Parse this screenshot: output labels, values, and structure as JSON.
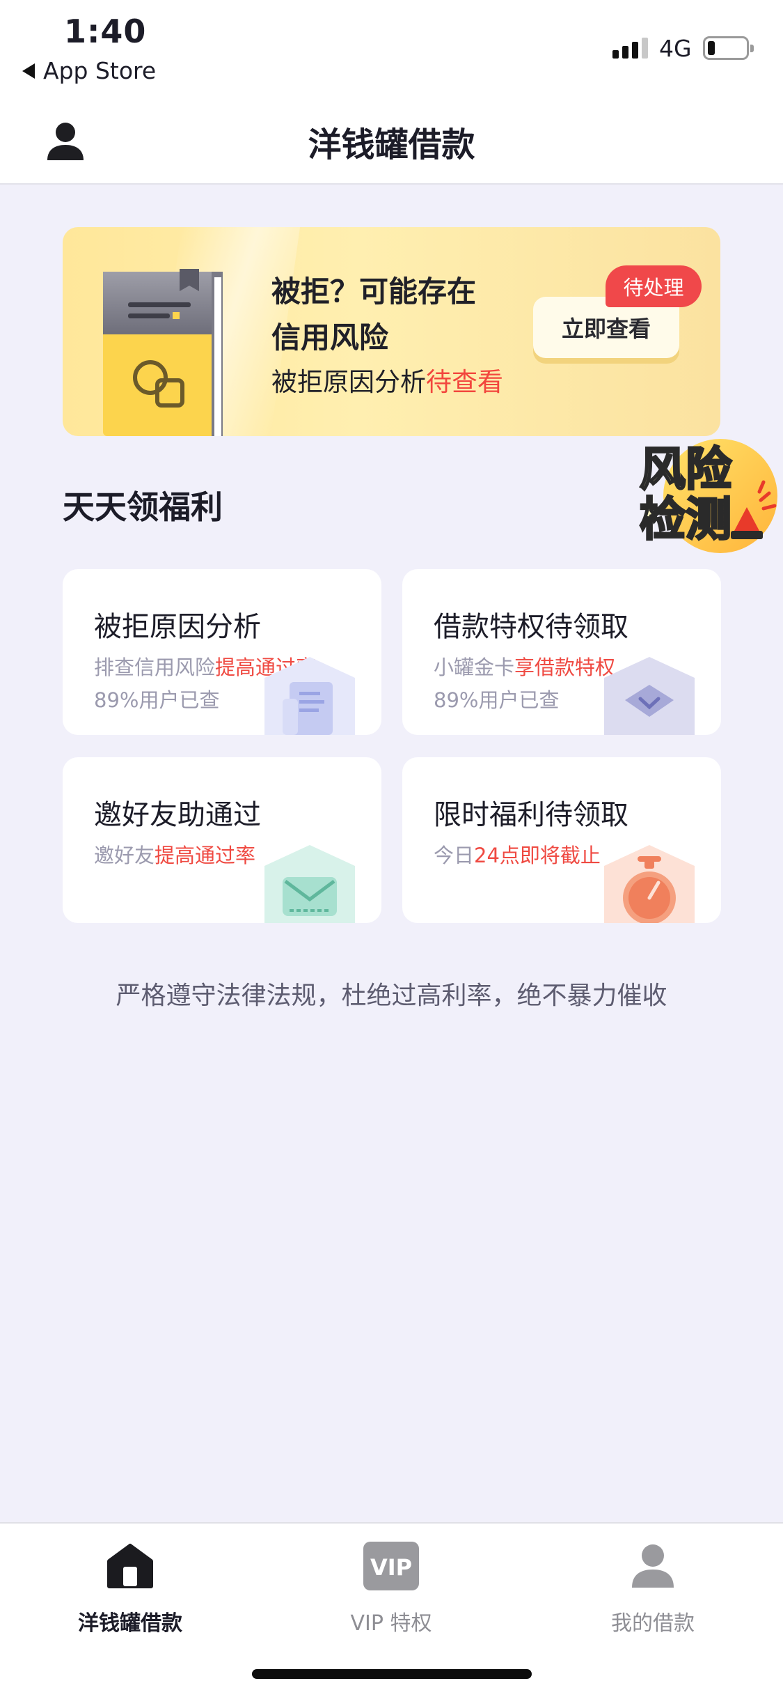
{
  "status_bar": {
    "time": "1:40",
    "back_label": "App Store",
    "network": "4G",
    "battery_level": 0.2
  },
  "header": {
    "title": "洋钱罐借款",
    "avatar_icon": "user-avatar-icon"
  },
  "banner": {
    "headline_line1": "被拒？可能存在",
    "headline_line2": "信用风险",
    "sub_prefix": "被拒原因分析",
    "sub_highlight": "待查看",
    "cta_label": "立即查看",
    "pending_badge": "待处理",
    "colors": {
      "highlight": "#f2463d",
      "badge": "#f0484a",
      "background": "#ffeaa4"
    }
  },
  "risk_badge": {
    "line1": "风险",
    "line2": "检测"
  },
  "benefits": {
    "title": "天天领福利",
    "cards": [
      {
        "title": "被拒原因分析",
        "desc_prefix": "排查信用风险",
        "desc_highlight": "提高通过率",
        "stat": "89%用户已查",
        "icon": "document-icon"
      },
      {
        "title": "借款特权待领取",
        "desc_prefix": "小罐金卡",
        "desc_highlight": "享借款特权",
        "stat": "89%用户已查",
        "icon": "diamond-card-icon"
      },
      {
        "title": "邀好友助通过",
        "desc_prefix": "邀好友",
        "desc_highlight": "提高通过率",
        "icon": "envelope-icon"
      },
      {
        "title": "限时福利待领取",
        "desc_prefix": "今日",
        "desc_highlight": "24点即将截止",
        "icon": "stopwatch-icon"
      }
    ]
  },
  "footer_note": "严格遵守法律法规，杜绝过高利率，绝不暴力催收",
  "tabbar": {
    "tabs": [
      {
        "label": "洋钱罐借款",
        "icon": "home-icon",
        "active": true
      },
      {
        "label": "VIP 特权",
        "icon": "vip-icon",
        "active": false
      },
      {
        "label": "我的借款",
        "icon": "person-icon",
        "active": false
      }
    ],
    "vip_icon_text": "VIP"
  }
}
